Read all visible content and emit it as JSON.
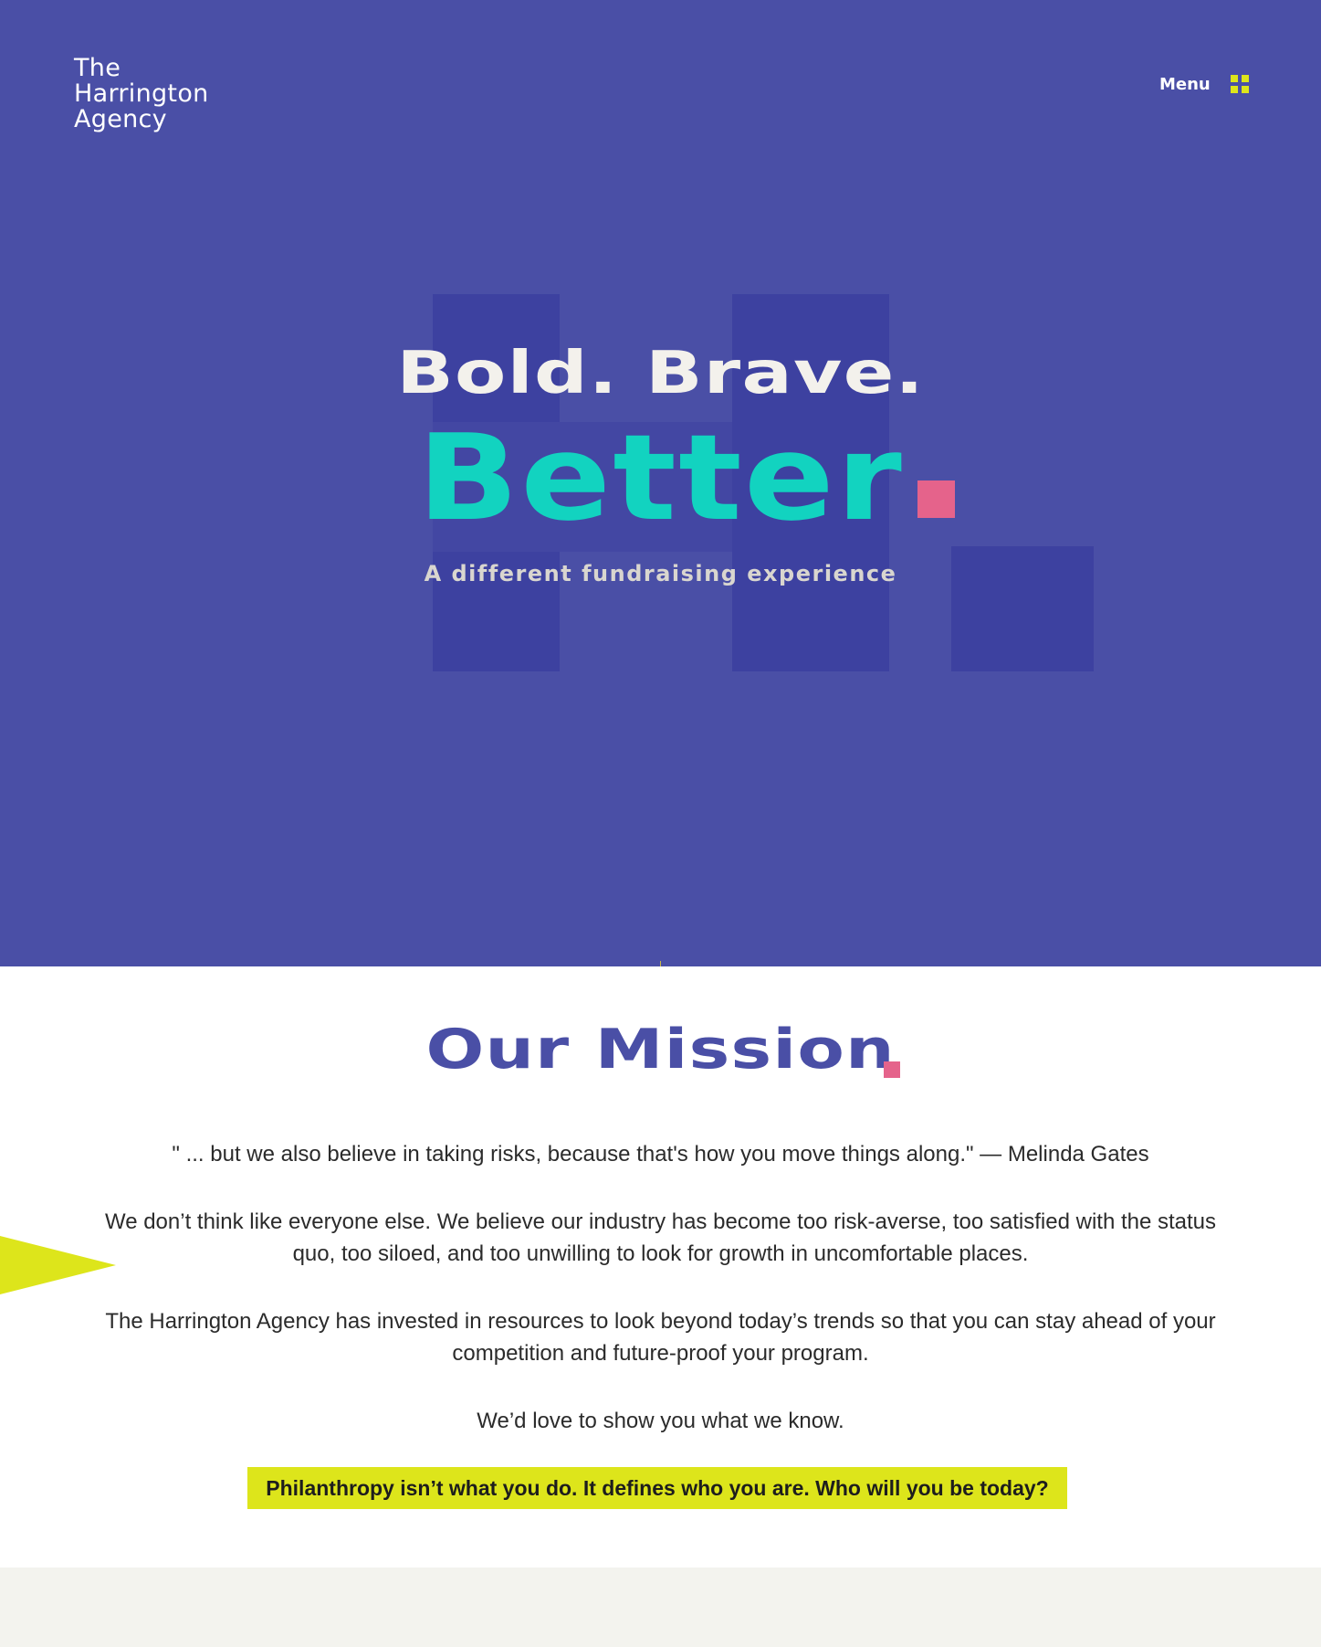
{
  "brand": {
    "logo_lines": [
      "The",
      "Harrington",
      "Agency"
    ],
    "colors": {
      "hero_bg": "#4a4fa6",
      "accent_teal": "#12d3c0",
      "accent_pink": "#e5638b",
      "accent_yellow": "#dde51b"
    }
  },
  "nav": {
    "menu_label": "Menu",
    "menu_icon": "grid-icon"
  },
  "hero": {
    "line1": "Bold. Brave.",
    "line2": "Better",
    "subtitle": "A different fundraising experience"
  },
  "mission": {
    "title": "Our Mission",
    "quote": "\" ... but we also believe in taking risks, because that's how you move things along.\" — Melinda Gates",
    "paragraph1": "We don’t think like everyone else. We believe our industry has become too risk-averse, too satisfied with the status quo, too siloed, and too unwilling to look for growth in uncomfortable places.",
    "paragraph2": "The Harrington Agency has invested in resources to look beyond today’s trends so that you can stay ahead of your competition and future-proof your program.",
    "paragraph3": "We’d love to show you what we know.",
    "cta": "Philanthropy isn’t what you do. It defines who you are. Who will you be today?"
  }
}
